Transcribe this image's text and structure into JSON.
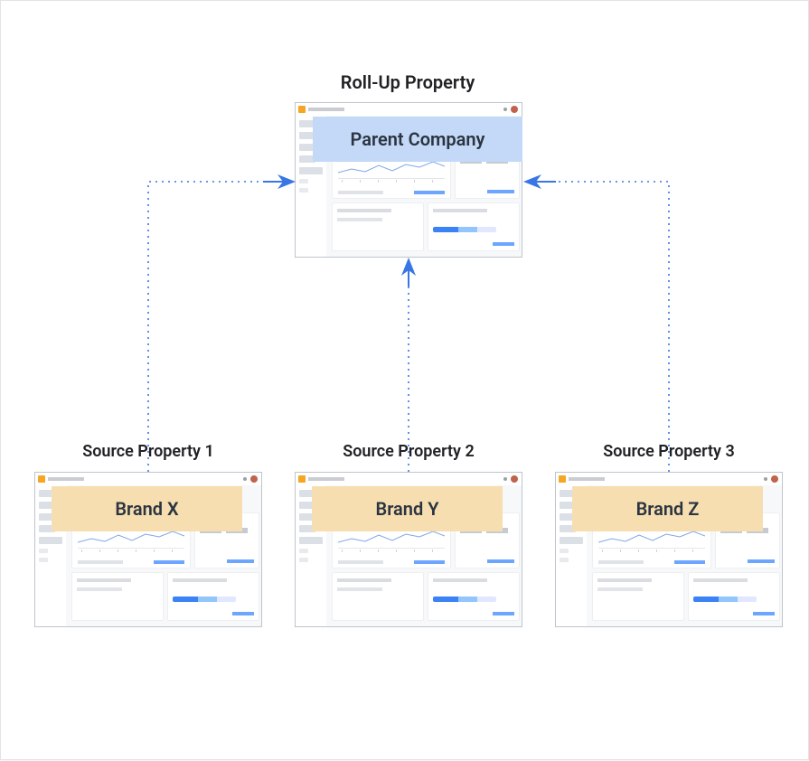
{
  "rollup": {
    "title": "Roll-Up Property",
    "banner_label": "Parent Company"
  },
  "sources": [
    {
      "title": "Source Property 1",
      "banner_label": "Brand  X"
    },
    {
      "title": "Source Property 2",
      "banner_label": "Brand Y"
    },
    {
      "title": "Source Property 3",
      "banner_label": "Brand Z"
    }
  ],
  "colors": {
    "banner_parent": "#c3d9f7",
    "banner_source": "#f6deb0",
    "arrow": "#3876e4"
  }
}
